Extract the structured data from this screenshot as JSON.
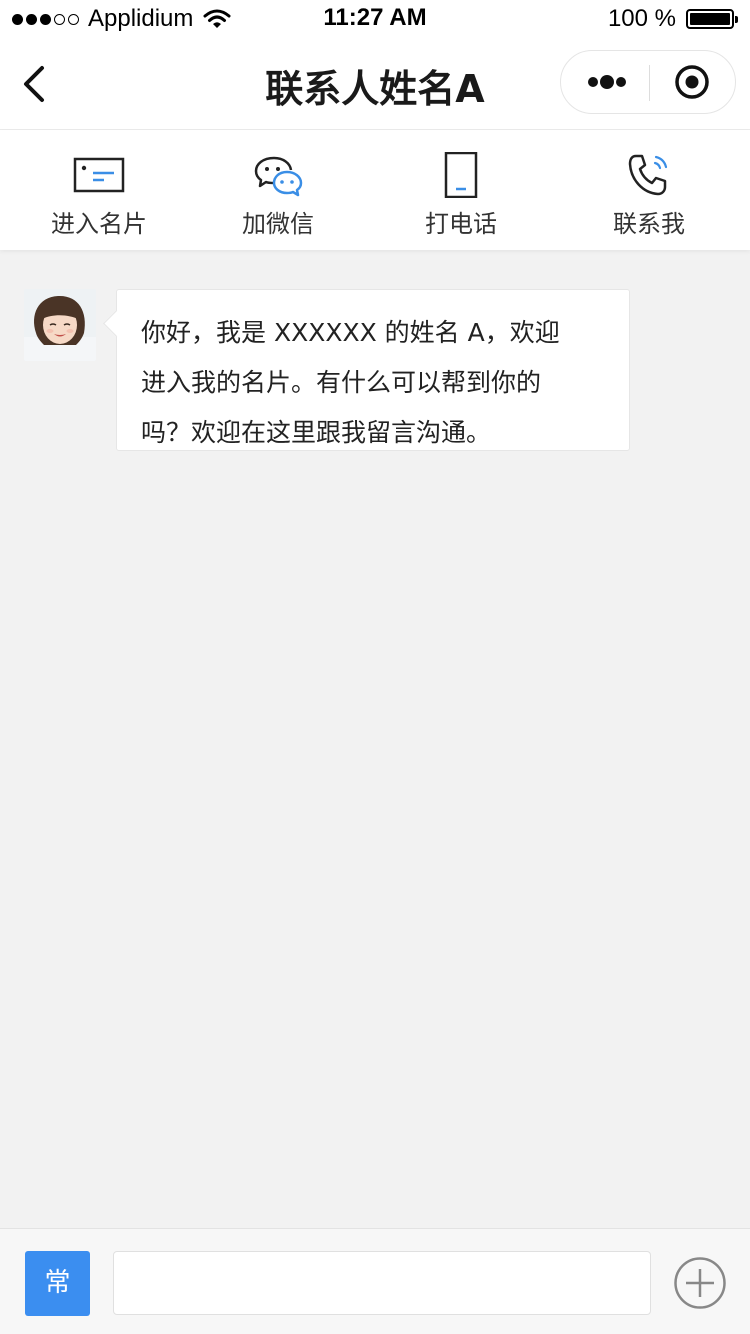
{
  "status_bar": {
    "carrier": "Applidium",
    "time": "11:27 AM",
    "battery_text": "100 %",
    "battery_level": 1.0,
    "signal_bars_filled": 3,
    "signal_bars_total": 5
  },
  "nav": {
    "title": "联系人姓名A",
    "back_icon": "chevron-left-icon",
    "more_icon": "more-dots-icon",
    "close_icon": "record-target-icon"
  },
  "quick_actions": [
    {
      "label": "进入名片",
      "icon": "business-card-icon"
    },
    {
      "label": "加微信",
      "icon": "wechat-icon"
    },
    {
      "label": "打电话",
      "icon": "phone-device-icon"
    },
    {
      "label": "联系我",
      "icon": "phone-call-icon"
    }
  ],
  "chat": {
    "messages": [
      {
        "sender": "contact",
        "lines": [
          "你好，我是 XXXXXX 的姓名 A，欢迎",
          "进入我的名片。有什么可以帮到你的",
          "吗？欢迎在这里跟我留言沟通。"
        ]
      }
    ]
  },
  "input_bar": {
    "common_label": "常",
    "input_value": "",
    "input_placeholder": "",
    "plus_icon": "plus-circle-icon"
  },
  "colors": {
    "accent_blue": "#3b8ef0",
    "icon_blue": "#3a8ee6",
    "background": "#f2f2f2"
  }
}
